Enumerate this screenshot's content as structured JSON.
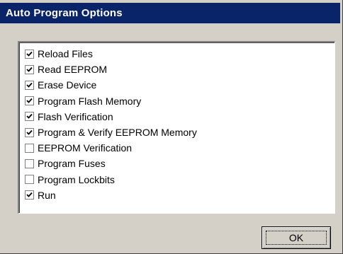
{
  "window": {
    "title": "Auto Program Options"
  },
  "options": [
    {
      "label": "Reload Files",
      "checked": true
    },
    {
      "label": "Read EEPROM",
      "checked": true
    },
    {
      "label": "Erase Device",
      "checked": true
    },
    {
      "label": "Program Flash Memory",
      "checked": true
    },
    {
      "label": "Flash Verification",
      "checked": true
    },
    {
      "label": "Program & Verify EEPROM Memory",
      "checked": true
    },
    {
      "label": "EEPROM Verification",
      "checked": false
    },
    {
      "label": "Program Fuses",
      "checked": false
    },
    {
      "label": "Program Lockbits",
      "checked": false
    },
    {
      "label": "Run",
      "checked": true
    }
  ],
  "buttons": {
    "ok_label": "OK"
  },
  "colors": {
    "titlebar": "#0a246a",
    "dialog_face": "#d4d0c8",
    "list_background": "#ffffff"
  }
}
